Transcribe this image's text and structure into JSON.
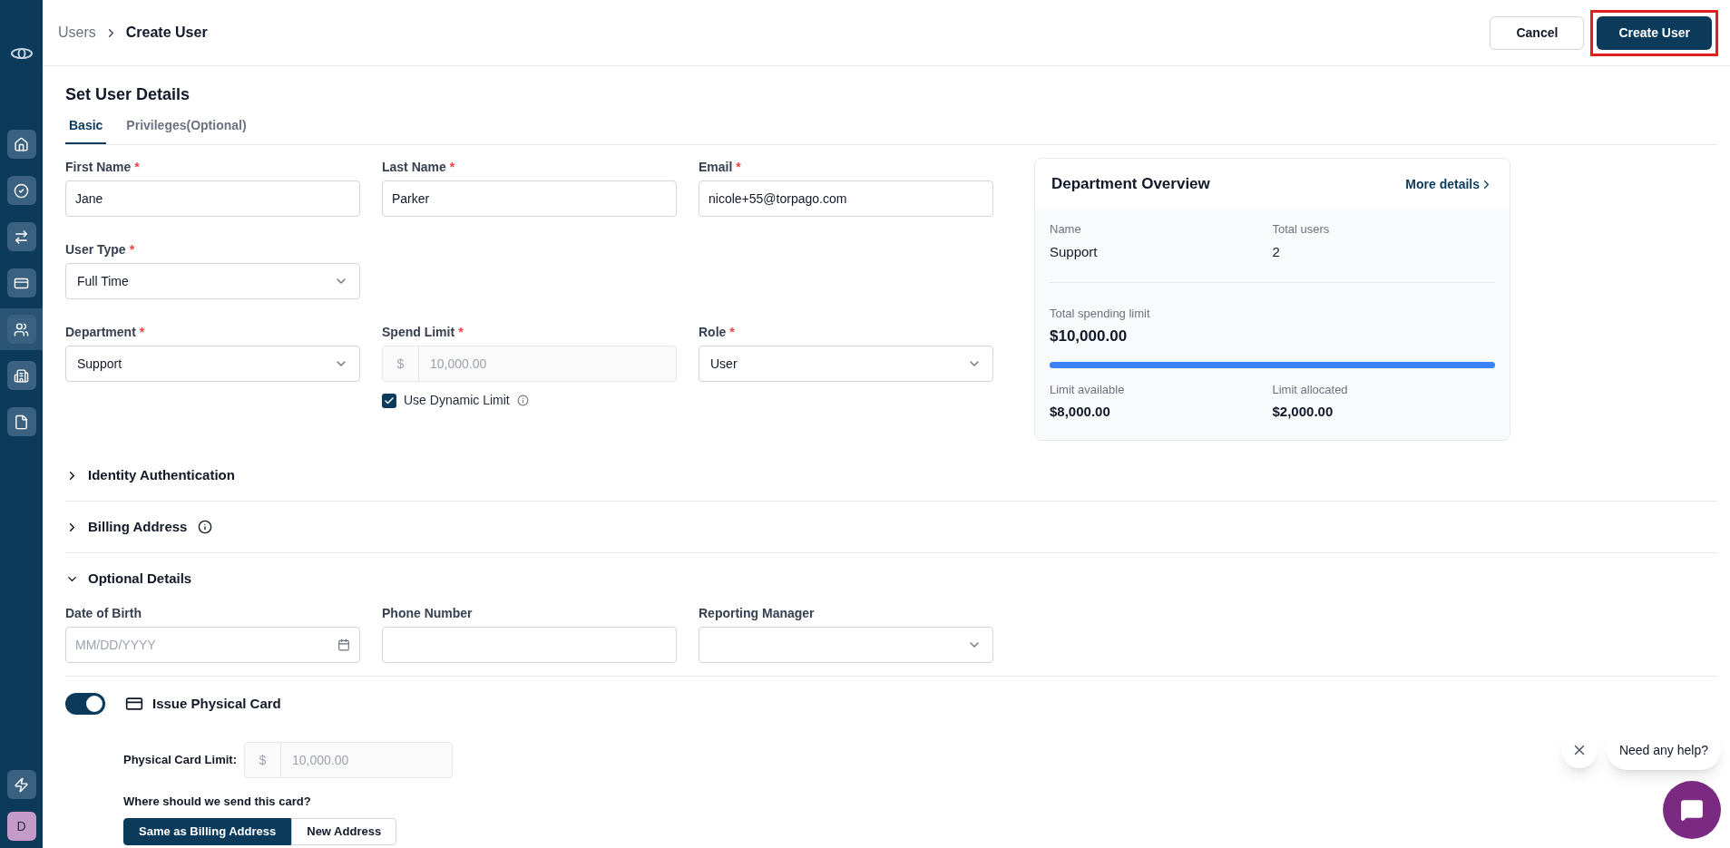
{
  "sidebar": {
    "items": [
      {
        "selected": false
      },
      {
        "selected": false
      },
      {
        "selected": false
      },
      {
        "selected": false
      },
      {
        "selected": true
      },
      {
        "selected": false
      },
      {
        "selected": false
      }
    ],
    "avatar": "D"
  },
  "breadcrumb": [
    "Users",
    "Create User"
  ],
  "actions": {
    "cancel": "Cancel",
    "create": "Create User",
    "create_highlighted": true
  },
  "title": "Set User Details",
  "tabs": [
    {
      "label": "Basic",
      "selected": true
    },
    {
      "label": "Privileges(Optional)",
      "selected": false
    }
  ],
  "fields": [
    {
      "label": "First Name",
      "required": "*",
      "kind": "text",
      "value": "Jane"
    },
    {
      "label": "Last Name",
      "required": "*",
      "kind": "text",
      "value": "Parker"
    },
    {
      "label": "Email",
      "required": "*",
      "kind": "text",
      "value": "nicole+55@torpago.com"
    },
    {
      "label": "User Type",
      "required": "*",
      "kind": "select",
      "value": "Full Time"
    },
    {
      "kind": "empty"
    },
    {
      "kind": "empty"
    },
    {
      "label": "Department",
      "required": "*",
      "kind": "select",
      "value": "Support"
    },
    {
      "label": "Spend Limit",
      "required": "*",
      "kind": "money",
      "prefix": "$",
      "value": "10,000.00",
      "disabled": true,
      "checkbox": {
        "label": "Use Dynamic Limit",
        "checked": true
      }
    },
    {
      "label": "Role",
      "required": "*",
      "kind": "select",
      "value": "User"
    }
  ],
  "overview": {
    "title": "Department Overview",
    "link": "More details",
    "name_label": "Name",
    "name": "Support",
    "users_label": "Total users",
    "users": "2",
    "limit_label": "Total spending limit",
    "limit": "$10,000.00",
    "level": 1,
    "available_label": "Limit available",
    "available": "$8,000.00",
    "allocated_label": "Limit allocated",
    "allocated": "$2,000.00"
  },
  "sections": [
    {
      "title": "Identity Authentication",
      "expanded": false,
      "info": false
    },
    {
      "title": "Billing Address",
      "expanded": false,
      "info": true
    },
    {
      "title": "Optional Details",
      "expanded": true,
      "info": false
    }
  ],
  "optional_fields": [
    {
      "label": "Date of Birth",
      "kind": "date",
      "placeholder": "MM/DD/YYYY"
    },
    {
      "label": "Phone Number",
      "kind": "text"
    },
    {
      "label": "Reporting Manager",
      "kind": "select"
    }
  ],
  "physical_card": {
    "on": true,
    "label": "Issue Physical Card",
    "limit_label": "Physical Card Limit:",
    "prefix": "$",
    "limit": "10,000.00",
    "question": "Where should we send this card?",
    "options": [
      {
        "label": "Same as Billing Address",
        "selected": true
      },
      {
        "label": "New Address",
        "selected": false
      }
    ]
  },
  "help": {
    "text": "Need any help?"
  }
}
